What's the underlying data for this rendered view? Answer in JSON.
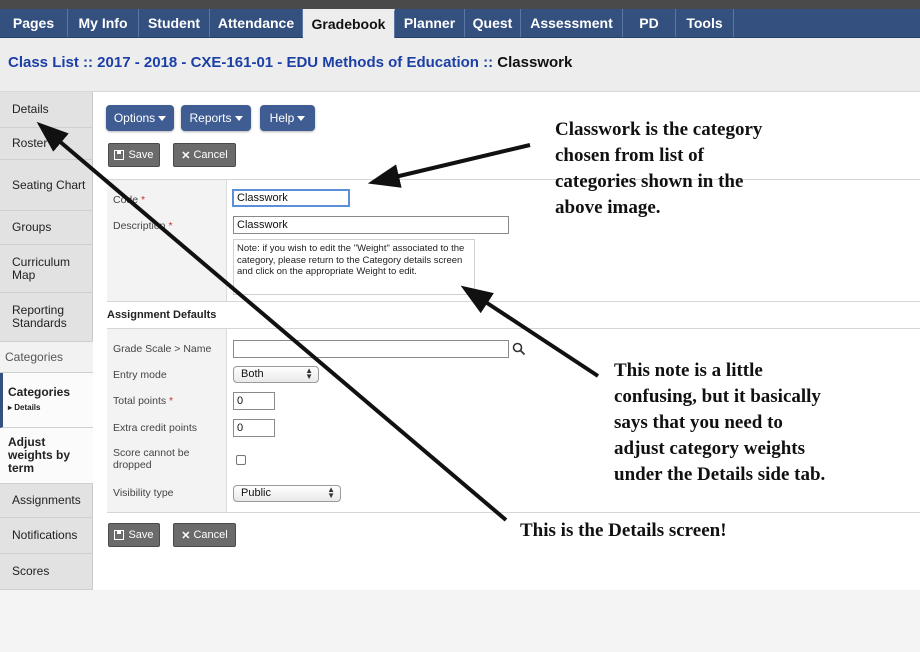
{
  "nav": {
    "tabs": [
      {
        "label": "Pages"
      },
      {
        "label": "My Info"
      },
      {
        "label": "Student"
      },
      {
        "label": "Attendance"
      },
      {
        "label": "Gradebook",
        "active": true
      },
      {
        "label": "Planner"
      },
      {
        "label": "Quest"
      },
      {
        "label": "Assessment"
      },
      {
        "label": "PD"
      },
      {
        "label": "Tools"
      }
    ]
  },
  "title": {
    "link_text": "Class List :: 2017 - 2018 - CXE-161-01 - EDU Methods of Education",
    "separator": " :: ",
    "current": "Classwork"
  },
  "sidebar": {
    "details": "Details",
    "roster": "Roster",
    "seating_chart": "Seating Chart",
    "groups": "Groups",
    "curriculum_map": "Curriculum Map",
    "reporting_standards": "Reporting Standards",
    "categories_heading": "Categories",
    "categories": "Categories",
    "categories_sub": "▸ Details",
    "adjust_weights": "Adjust weights by term",
    "assignments": "Assignments",
    "notifications": "Notifications",
    "scores": "Scores"
  },
  "toolbar": {
    "options": "Options",
    "reports": "Reports",
    "help": "Help",
    "save": "Save",
    "cancel": "Cancel"
  },
  "form": {
    "code_label": "Code",
    "code_value": "Classwork",
    "description_label": "Description",
    "description_value": "Classwork",
    "note": "Note: if you wish to edit the \"Weight\" associated to the category, please return to the Category details screen and click on the appropriate Weight to edit."
  },
  "assignment_defaults": {
    "title": "Assignment Defaults",
    "grade_scale_label": "Grade Scale > Name",
    "grade_scale_value": "",
    "entry_mode_label": "Entry mode",
    "entry_mode_value": "Both",
    "total_points_label": "Total points",
    "total_points_value": "0",
    "extra_credit_label": "Extra credit points",
    "extra_credit_value": "0",
    "score_dropped_label": "Score cannot be dropped",
    "score_dropped_checked": false,
    "visibility_label": "Visibility type",
    "visibility_value": "Public"
  },
  "annotations": {
    "top_line1": "Classwork is the category",
    "top_line2": "chosen from list of",
    "top_line3": "categories shown in the",
    "top_line4": "above image.",
    "mid_line1": "This note is a little",
    "mid_line2": "confusing, but it basically",
    "mid_line3": "says that you need to",
    "mid_line4": "adjust category weights",
    "mid_line5": "under the Details side tab.",
    "bottom": "This is the Details screen!"
  },
  "colors": {
    "nav_bg": "#34507f",
    "link_blue": "#1c3fa6",
    "button_blue": "#3f5d92"
  }
}
